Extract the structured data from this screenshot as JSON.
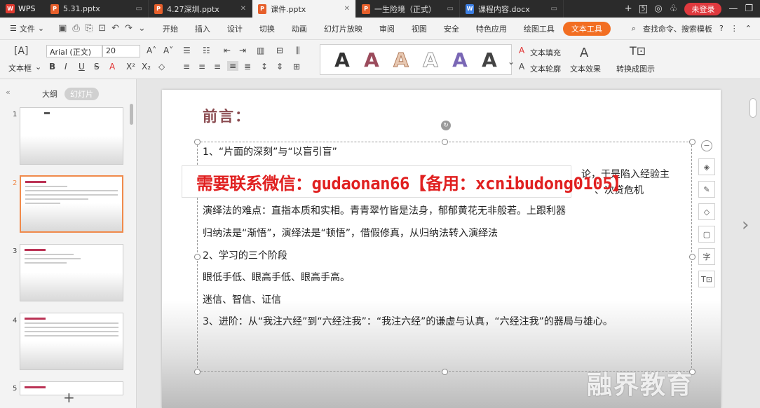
{
  "titlebar": {
    "app": "WPS",
    "tabs": [
      {
        "label": "5.31.pptx",
        "type": "p"
      },
      {
        "label": "4.27深圳.pptx",
        "type": "p"
      },
      {
        "label": "课件.pptx",
        "type": "p",
        "active": true
      },
      {
        "label": "一生险境（正式）",
        "type": "p"
      },
      {
        "label": "课程内容.docx",
        "type": "w"
      }
    ],
    "tab_count": "5",
    "login": "未登录"
  },
  "menubar": {
    "file": "文件",
    "items": [
      "开始",
      "插入",
      "设计",
      "切换",
      "动画",
      "幻灯片放映",
      "审阅",
      "视图",
      "安全",
      "特色应用",
      "绘图工具",
      "文本工具"
    ],
    "active": "文本工具",
    "search": "查找命令、搜索模板"
  },
  "ribbon": {
    "textbox_label": "文本框",
    "font_name": "Arial (正文)",
    "font_size": "20",
    "text_fill": "文本填充",
    "text_outline": "文本轮廓",
    "text_effect": "文本效果",
    "convert": "转换成图示"
  },
  "leftpanel": {
    "tabs": [
      "大纲",
      "幻灯片"
    ],
    "slide_numbers": [
      "1",
      "2",
      "3",
      "4",
      "5"
    ]
  },
  "slide": {
    "title": "前言：",
    "lines": [
      "1、“片面的深刻”与“以盲引盲”",
      "论，于是陷入经验主",
      "、次贷危机",
      "演绎法的难点：直指本质和实相。青青翠竹皆是法身，郁郁黄花无非般若。上跟利器",
      "归纳法是“渐悟”，演绎法是“顿悟”，借假修真，从归纳法转入演绎法",
      "2、学习的三个阶段",
      "眼低手低、眼高手低、眼高手高。",
      "迷信、智信、证信",
      "3、进阶：从“我注六经”到“六经注我”：“我注六经”的谦虚与认真，“六经注我”的器局与雄心。"
    ],
    "banner": "需要联系微信：gudaonan66【备用：xcnibudong0105】",
    "watermark": "融界教育"
  },
  "colors": {
    "accent": "#f26e22",
    "title": "#8a4a4f",
    "banner_text": "#e02020"
  }
}
